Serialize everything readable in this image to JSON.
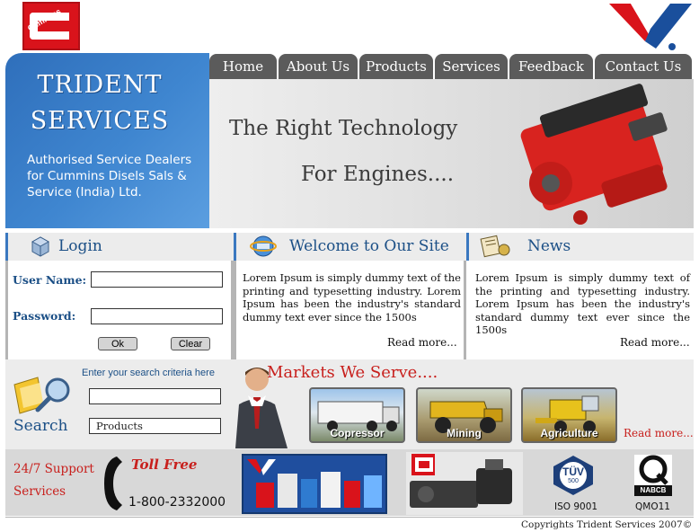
{
  "brand": {
    "cummins_logo_text": "Cummins",
    "trident_title_line1": "TRIDENT",
    "trident_title_line2": "SERVICES",
    "description": "Authorised Service Dealers for Cummins Disels Sals & Service (India) Ltd."
  },
  "nav": {
    "items": [
      "Home",
      "About Us",
      "Products",
      "Services",
      "Feedback",
      "Contact Us"
    ]
  },
  "banner": {
    "line1": "The Right Technology",
    "line2": "For Engines...."
  },
  "login": {
    "title": "Login",
    "username_label": "User Name:",
    "password_label": "Password:",
    "username_value": "",
    "password_value": "",
    "ok_label": "Ok",
    "clear_label": "Clear"
  },
  "welcome": {
    "title": "Welcome to Our Site",
    "body": "Lorem Ipsum is simply dummy text of the printing and typesetting industry. Lorem Ipsum has been the industry's standard dummy text ever since the 1500s",
    "read_more": "Read more..."
  },
  "news": {
    "title": "News",
    "body": "Lorem Ipsum is simply dummy text of the printing and typesetting industry. Lorem Ipsum has been the industry's standard dummy text ever since the 1500s",
    "read_more": "Read more..."
  },
  "search": {
    "hint": "Enter your search criteria here",
    "label": "Search",
    "query_value": "",
    "category_value": "Products"
  },
  "markets": {
    "title": "Markets We Serve....",
    "items": [
      "Copressor",
      "Mining",
      "Agriculture"
    ],
    "read_more": "Read more..."
  },
  "support": {
    "line1": "24/7 Support",
    "line2": "Services",
    "toll_free_label": "Toll Free",
    "phone": "1-800-2332000"
  },
  "certs": {
    "iso_badge": "TÜV",
    "iso_sub": "500",
    "iso_label": "ISO 9001",
    "nabcb_badge": "NABCB",
    "nabcb_label": "QMO11"
  },
  "footer": {
    "copyright": "Copyrights Trident Services 2007©"
  },
  "colors": {
    "accent_blue": "#1b4f86",
    "panel_blue": "#3f86d0",
    "nav_grey": "#5b5b5b",
    "brand_red": "#d9131b"
  }
}
